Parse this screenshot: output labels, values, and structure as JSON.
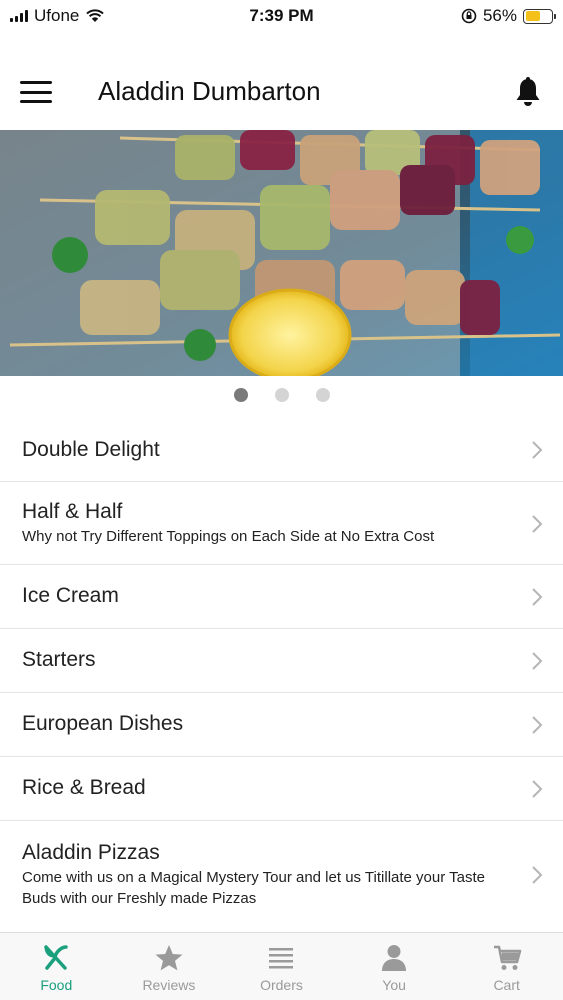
{
  "status_bar": {
    "carrier": "Ufone",
    "time": "7:39 PM",
    "battery_percent": "56%",
    "battery_level": 0.56,
    "battery_color": "#f4c11b",
    "icons": [
      "signal-icon",
      "wifi-icon",
      "orientation-lock-icon",
      "battery-icon"
    ]
  },
  "header": {
    "title": "Aladdin Dumbarton",
    "menu_icon": "hamburger-icon",
    "notification_icon": "bell-icon"
  },
  "carousel": {
    "image": "grilled chicken and onion skewers with lemon",
    "page_count": 3,
    "active_page": 1
  },
  "categories": [
    {
      "name": "Double Delight",
      "description": ""
    },
    {
      "name": "Half & Half",
      "description": "Why not Try Different Toppings on Each Side at No Extra Cost"
    },
    {
      "name": "Ice Cream",
      "description": ""
    },
    {
      "name": "Starters",
      "description": ""
    },
    {
      "name": "European Dishes",
      "description": ""
    },
    {
      "name": "Rice & Bread",
      "description": ""
    },
    {
      "name": "Aladdin Pizzas",
      "description": "Come with us on a Magical Mystery Tour and let us Titillate your Taste Buds with our Freshly made Pizzas"
    }
  ],
  "tabs": [
    {
      "label": "Food",
      "icon": "fork-knife-icon",
      "active": true
    },
    {
      "label": "Reviews",
      "icon": "star-icon",
      "active": false
    },
    {
      "label": "Orders",
      "icon": "list-icon",
      "active": false
    },
    {
      "label": "You",
      "icon": "person-icon",
      "active": false
    },
    {
      "label": "Cart",
      "icon": "cart-icon",
      "active": false
    }
  ],
  "colors": {
    "accent": "#1aa07c",
    "inactive_tab": "#9a9a9a",
    "divider": "#e6e6e6"
  }
}
